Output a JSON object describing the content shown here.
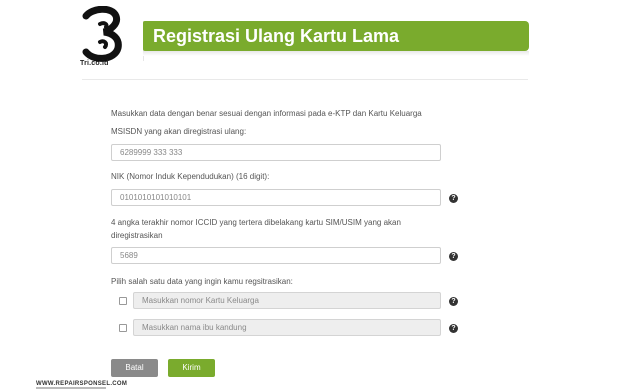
{
  "brand": {
    "logo_text": "Tri.co.id"
  },
  "header": {
    "title": "Registrasi Ulang Kartu Lama"
  },
  "form": {
    "intro": "Masukkan data dengan benar sesuai dengan informasi pada e-KTP dan Kartu Keluarga",
    "msisdn_label": "MSISDN yang akan diregistrasi ulang:",
    "msisdn_value": "6289999 333 333",
    "nik_label": "NIK (Nomor Induk Kependudukan) (16 digit):",
    "nik_value": "0101010101010101",
    "iccid_label": "4 angka terakhir nomor ICCID yang tertera dibelakang kartu SIM/USIM yang akan diregistrasikan",
    "iccid_value": "5689",
    "choice_label": "Pilih salah satu data yang ingin kamu regsitrasikan:",
    "kk_placeholder": "Masukkan nomor Kartu Keluarga",
    "mother_placeholder": "Masukkan nama ibu kandung",
    "help_glyph": "?"
  },
  "buttons": {
    "cancel_label": "Batal",
    "submit_label": "Kirim"
  },
  "watermark": {
    "text": "WWW.REPAIRSPONSEL.COM"
  }
}
